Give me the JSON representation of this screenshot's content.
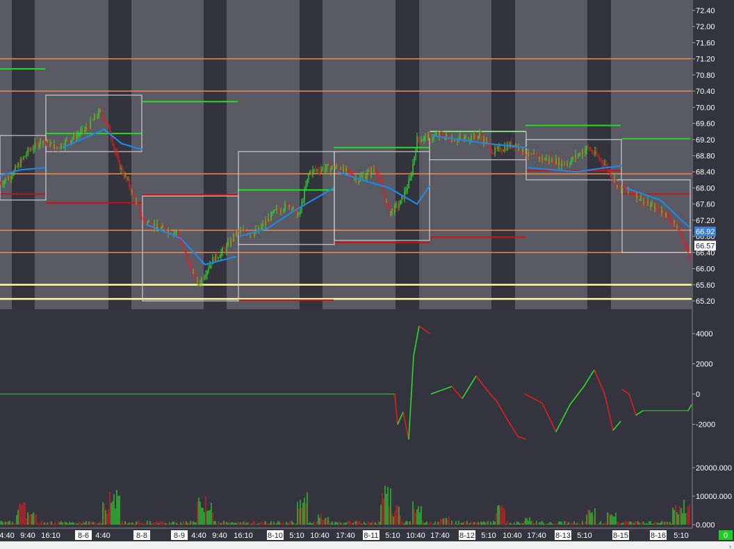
{
  "colors": {
    "background": "#34343f",
    "session_band": "#5a5a65",
    "band_alt": "#3a3a47",
    "up": "#2bdc2b",
    "down": "#e01e1e",
    "vwap": "#1e88e5",
    "level_orange": "#f08a4b",
    "level_yellow": "#ffff99",
    "level_green": "#22dd22",
    "level_red": "#cc1111",
    "envelope": "#d8d8d8",
    "axis_text": "#ffffff",
    "price_tag_blue": "#3d7fd6",
    "price_tag_white": "#ffffff"
  },
  "price_axis": {
    "ticks": [
      "72.40",
      "72.00",
      "71.60",
      "71.20",
      "70.80",
      "70.40",
      "70.00",
      "69.60",
      "69.20",
      "68.80",
      "68.40",
      "68.00",
      "67.60",
      "67.20",
      "66.80",
      "66.40",
      "66.00",
      "65.60",
      "65.20"
    ],
    "tag_blue": "66.92",
    "tag_white": "66.57"
  },
  "oscillator_axis": {
    "ticks": [
      "4000",
      "2000",
      "0",
      "-2000"
    ]
  },
  "volume_axis": {
    "ticks": [
      "20000.000",
      "10000.000",
      "0.000"
    ]
  },
  "time_axis": {
    "labels": [
      "4:40",
      "9:40",
      "16:10",
      "8-6",
      "4:40",
      "8-8",
      "8-9",
      "4:40",
      "9:40",
      "16:10",
      "8-10",
      "5:10",
      "10:40",
      "17:40",
      "8-11",
      "5:10",
      "10:40",
      "17:40",
      "8-12",
      "5:10",
      "10:40",
      "17:40",
      "8-13",
      "5:10",
      "8-15",
      "8-16",
      "5:10"
    ]
  },
  "corner_badge": "0",
  "chart_data": [
    {
      "type": "candlestick",
      "title": "",
      "ylim": [
        65.0,
        72.6
      ],
      "levels_orange": [
        71.2,
        70.4,
        68.35,
        66.95,
        66.4
      ],
      "levels_yellow": [
        65.6,
        65.25
      ],
      "close_path": [
        {
          "x": 0,
          "y": 68.1
        },
        {
          "x": 20,
          "y": 68.4
        },
        {
          "x": 40,
          "y": 68.9
        },
        {
          "x": 60,
          "y": 69.2
        },
        {
          "x": 80,
          "y": 69.0
        },
        {
          "x": 100,
          "y": 69.2
        },
        {
          "x": 120,
          "y": 69.4
        },
        {
          "x": 145,
          "y": 69.9
        },
        {
          "x": 160,
          "y": 69.3
        },
        {
          "x": 170,
          "y": 68.6
        },
        {
          "x": 185,
          "y": 68.1
        },
        {
          "x": 205,
          "y": 67.2
        },
        {
          "x": 230,
          "y": 67.0
        },
        {
          "x": 255,
          "y": 66.9
        },
        {
          "x": 270,
          "y": 66.2
        },
        {
          "x": 285,
          "y": 65.6
        },
        {
          "x": 305,
          "y": 66.2
        },
        {
          "x": 325,
          "y": 66.5
        },
        {
          "x": 340,
          "y": 66.9
        },
        {
          "x": 370,
          "y": 66.9
        },
        {
          "x": 395,
          "y": 67.4
        },
        {
          "x": 415,
          "y": 67.6
        },
        {
          "x": 430,
          "y": 67.3
        },
        {
          "x": 445,
          "y": 68.4
        },
        {
          "x": 470,
          "y": 68.5
        },
        {
          "x": 490,
          "y": 68.5
        },
        {
          "x": 515,
          "y": 68.2
        },
        {
          "x": 540,
          "y": 68.5
        },
        {
          "x": 560,
          "y": 67.4
        },
        {
          "x": 575,
          "y": 67.6
        },
        {
          "x": 590,
          "y": 68.2
        },
        {
          "x": 600,
          "y": 69.2
        },
        {
          "x": 630,
          "y": 69.3
        },
        {
          "x": 660,
          "y": 69.2
        },
        {
          "x": 690,
          "y": 69.3
        },
        {
          "x": 710,
          "y": 68.9
        },
        {
          "x": 740,
          "y": 69.1
        },
        {
          "x": 760,
          "y": 68.8
        },
        {
          "x": 790,
          "y": 68.7
        },
        {
          "x": 815,
          "y": 68.6
        },
        {
          "x": 845,
          "y": 69.0
        },
        {
          "x": 870,
          "y": 68.6
        },
        {
          "x": 890,
          "y": 68.0
        },
        {
          "x": 910,
          "y": 67.9
        },
        {
          "x": 930,
          "y": 67.6
        },
        {
          "x": 955,
          "y": 67.4
        },
        {
          "x": 975,
          "y": 67.0
        },
        {
          "x": 992,
          "y": 66.3
        }
      ],
      "vwap_path": [
        {
          "x": 0,
          "y": 68.3
        },
        {
          "x": 30,
          "y": 68.45
        },
        {
          "x": 65,
          "y": 68.5
        },
        {
          "x": 90,
          "y": 69.0
        },
        {
          "x": 150,
          "y": 69.45
        },
        {
          "x": 175,
          "y": 69.1
        },
        {
          "x": 205,
          "y": 68.95
        },
        {
          "x": 210,
          "y": 67.1
        },
        {
          "x": 260,
          "y": 66.75
        },
        {
          "x": 295,
          "y": 66.1
        },
        {
          "x": 340,
          "y": 66.3
        },
        {
          "x": 345,
          "y": 66.8
        },
        {
          "x": 385,
          "y": 67.0
        },
        {
          "x": 420,
          "y": 67.4
        },
        {
          "x": 480,
          "y": 68.0
        },
        {
          "x": 485,
          "y": 68.4
        },
        {
          "x": 520,
          "y": 68.2
        },
        {
          "x": 560,
          "y": 68.0
        },
        {
          "x": 600,
          "y": 67.6
        },
        {
          "x": 618,
          "y": 68.05
        },
        {
          "x": 620,
          "y": 69.3
        },
        {
          "x": 700,
          "y": 69.1
        },
        {
          "x": 758,
          "y": 69.0
        },
        {
          "x": 760,
          "y": 68.5
        },
        {
          "x": 830,
          "y": 68.4
        },
        {
          "x": 870,
          "y": 68.5
        },
        {
          "x": 895,
          "y": 68.55
        },
        {
          "x": 900,
          "y": 68.0
        },
        {
          "x": 950,
          "y": 67.7
        },
        {
          "x": 993,
          "y": 67.0
        }
      ]
    },
    {
      "type": "line",
      "title": "",
      "ylim": [
        -3200,
        5000
      ],
      "series": [
        {
          "values_path": [
            {
              "x": 0,
              "y": 0
            },
            {
              "x": 568,
              "y": 0
            },
            {
              "x": 572,
              "y": -2000
            },
            {
              "x": 580,
              "y": -1200
            },
            {
              "x": 588,
              "y": -3000
            },
            {
              "x": 595,
              "y": 2500
            },
            {
              "x": 603,
              "y": 4500
            },
            {
              "x": 618,
              "y": 4000
            }
          ]
        },
        {
          "values_path": [
            {
              "x": 620,
              "y": 0
            },
            {
              "x": 650,
              "y": 500
            },
            {
              "x": 665,
              "y": -300
            },
            {
              "x": 685,
              "y": 1200
            },
            {
              "x": 700,
              "y": 300
            },
            {
              "x": 715,
              "y": -500
            },
            {
              "x": 730,
              "y": -1700
            },
            {
              "x": 745,
              "y": -2800
            },
            {
              "x": 757,
              "y": -3000
            }
          ]
        },
        {
          "values_path": [
            {
              "x": 755,
              "y": 0
            },
            {
              "x": 780,
              "y": -600
            },
            {
              "x": 800,
              "y": -2500
            },
            {
              "x": 820,
              "y": -700
            },
            {
              "x": 840,
              "y": 500
            },
            {
              "x": 855,
              "y": 1600
            },
            {
              "x": 870,
              "y": 0
            },
            {
              "x": 882,
              "y": -2400
            },
            {
              "x": 893,
              "y": -1800
            }
          ]
        },
        {
          "values_path": [
            {
              "x": 895,
              "y": 300
            },
            {
              "x": 905,
              "y": 0
            },
            {
              "x": 915,
              "y": -1400
            },
            {
              "x": 925,
              "y": -1100
            },
            {
              "x": 990,
              "y": -1100
            },
            {
              "x": 995,
              "y": -700
            }
          ]
        }
      ]
    },
    {
      "type": "bar",
      "title": "",
      "ylim": [
        0,
        25000
      ],
      "series": [
        {
          "name": "",
          "values": []
        }
      ]
    }
  ]
}
